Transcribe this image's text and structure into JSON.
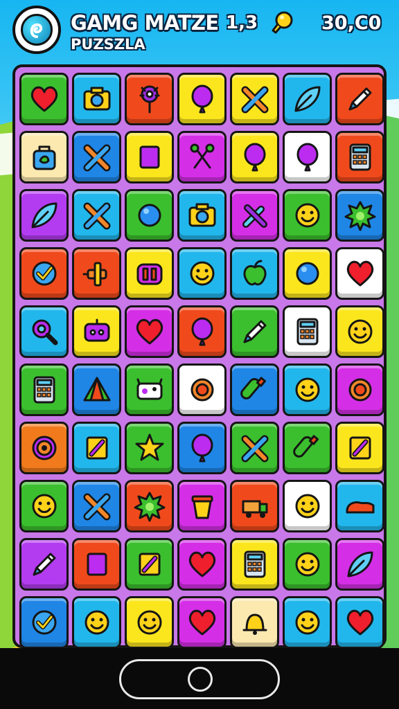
{
  "header": {
    "title": "GAMG MATZE",
    "subtitle": "PUZSZLA",
    "level": "1,3",
    "score": "30,C0",
    "logo_icon": "swirl-logo-icon",
    "hint_icon": "lightbulb-icon"
  },
  "colors": {
    "board_bg": "#c878e8",
    "outline": "#151515"
  },
  "board": {
    "rows": [
      [
        {
          "color": "#3bbf2e",
          "icon": "heart"
        },
        {
          "color": "#22b7ec",
          "icon": "camera"
        },
        {
          "color": "#f04a1c",
          "icon": "gear-pin"
        },
        {
          "color": "#fbe61e",
          "icon": "balloon"
        },
        {
          "color": "#fbe61e",
          "icon": "cross"
        },
        {
          "color": "#22b7ec",
          "icon": "leaf"
        },
        {
          "color": "#f04a1c",
          "icon": "pencil"
        }
      ],
      [
        {
          "color": "#fbe9b0",
          "icon": "bag"
        },
        {
          "color": "#1f86e6",
          "icon": "cross"
        },
        {
          "color": "#fbe61e",
          "icon": "square"
        },
        {
          "color": "#d42fe6",
          "icon": "scissors"
        },
        {
          "color": "#fbe61e",
          "icon": "balloon"
        },
        {
          "color": "#ffffff",
          "icon": "balloon"
        },
        {
          "color": "#f04a1c",
          "icon": "calculator"
        }
      ],
      [
        {
          "color": "#b43cf0",
          "icon": "leaf"
        },
        {
          "color": "#22b7ec",
          "icon": "cross"
        },
        {
          "color": "#3bbf2e",
          "icon": "circle"
        },
        {
          "color": "#22b7ec",
          "icon": "camera"
        },
        {
          "color": "#d42fe6",
          "icon": "tools"
        },
        {
          "color": "#3bbf2e",
          "icon": "smiley"
        },
        {
          "color": "#1f86e6",
          "icon": "splat"
        }
      ],
      [
        {
          "color": "#f04a1c",
          "icon": "check"
        },
        {
          "color": "#f04a1c",
          "icon": "plane"
        },
        {
          "color": "#fbe61e",
          "icon": "pause"
        },
        {
          "color": "#22b7ec",
          "icon": "smiley"
        },
        {
          "color": "#22b7ec",
          "icon": "apple"
        },
        {
          "color": "#fbe61e",
          "icon": "circle"
        },
        {
          "color": "#ffffff",
          "icon": "heart"
        }
      ],
      [
        {
          "color": "#22b7ec",
          "icon": "magnifier"
        },
        {
          "color": "#fbe61e",
          "icon": "robot"
        },
        {
          "color": "#d42fe6",
          "icon": "heart"
        },
        {
          "color": "#f04a1c",
          "icon": "balloon"
        },
        {
          "color": "#3bbf2e",
          "icon": "pencil"
        },
        {
          "color": "#ffffff",
          "icon": "calculator"
        },
        {
          "color": "#fbe61e",
          "icon": "smiley"
        }
      ],
      [
        {
          "color": "#3bbf2e",
          "icon": "calculator"
        },
        {
          "color": "#1f86e6",
          "icon": "triangle"
        },
        {
          "color": "#3bbf2e",
          "icon": "cow"
        },
        {
          "color": "#ffffff",
          "icon": "ring"
        },
        {
          "color": "#1f86e6",
          "icon": "bottle"
        },
        {
          "color": "#22b7ec",
          "icon": "smiley"
        },
        {
          "color": "#d42fe6",
          "icon": "ring"
        }
      ],
      [
        {
          "color": "#f07a1c",
          "icon": "gear"
        },
        {
          "color": "#22b7ec",
          "icon": "note"
        },
        {
          "color": "#3bbf2e",
          "icon": "star"
        },
        {
          "color": "#1f86e6",
          "icon": "balloon"
        },
        {
          "color": "#3bbf2e",
          "icon": "cross"
        },
        {
          "color": "#3bbf2e",
          "icon": "bottle"
        },
        {
          "color": "#fbe61e",
          "icon": "note"
        }
      ],
      [
        {
          "color": "#3bbf2e",
          "icon": "smiley"
        },
        {
          "color": "#1f86e6",
          "icon": "cross"
        },
        {
          "color": "#f04a1c",
          "icon": "splat"
        },
        {
          "color": "#d42fe6",
          "icon": "cup"
        },
        {
          "color": "#f04a1c",
          "icon": "truck"
        },
        {
          "color": "#ffffff",
          "icon": "smiley"
        },
        {
          "color": "#22b7ec",
          "icon": "shoe"
        }
      ],
      [
        {
          "color": "#b43cf0",
          "icon": "pencil"
        },
        {
          "color": "#f04a1c",
          "icon": "square"
        },
        {
          "color": "#3bbf2e",
          "icon": "note"
        },
        {
          "color": "#d42fe6",
          "icon": "heart"
        },
        {
          "color": "#fbe61e",
          "icon": "calculator"
        },
        {
          "color": "#3bbf2e",
          "icon": "smiley"
        },
        {
          "color": "#d42fe6",
          "icon": "leaf"
        }
      ],
      [
        {
          "color": "#1f86e6",
          "icon": "check"
        },
        {
          "color": "#22b7ec",
          "icon": "smiley"
        },
        {
          "color": "#fbe61e",
          "icon": "smiley"
        },
        {
          "color": "#d42fe6",
          "icon": "heart"
        },
        {
          "color": "#fbe9b0",
          "icon": "bell"
        },
        {
          "color": "#22b7ec",
          "icon": "smiley"
        },
        {
          "color": "#22b7ec",
          "icon": "heart"
        }
      ]
    ]
  },
  "navbar": {
    "home_icon": "home-circle-icon"
  }
}
